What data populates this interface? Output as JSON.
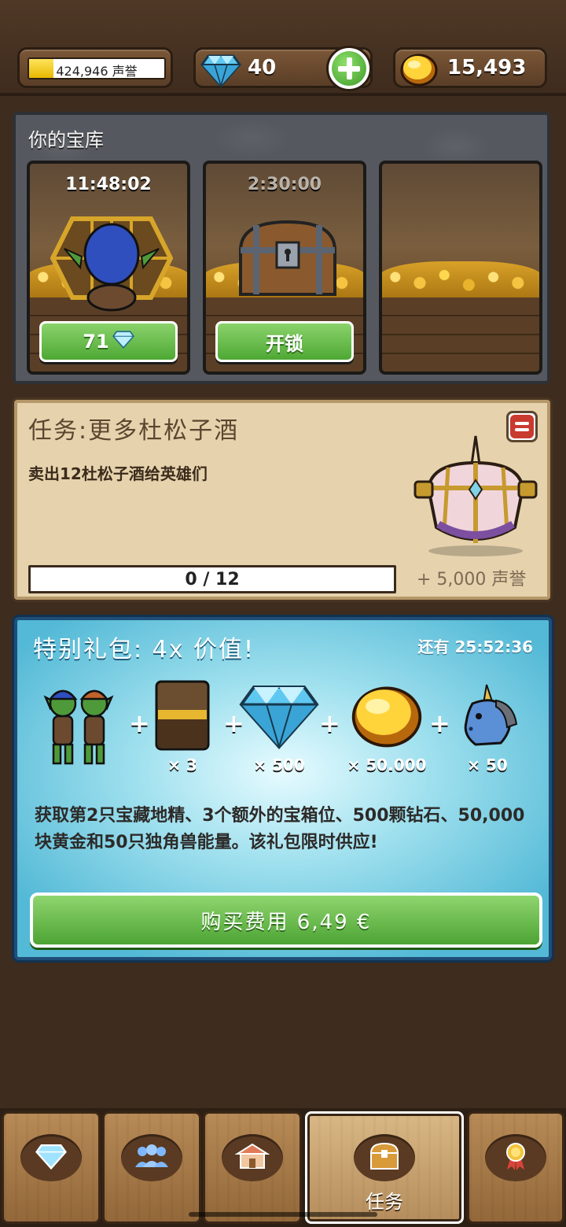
{
  "topbar": {
    "fame_text": "424,946 声誉",
    "fame_progress": 0.18,
    "gems": "40",
    "gold": "15,493"
  },
  "vault": {
    "title": "你的宝库",
    "slots": [
      {
        "timer": "11:48:02",
        "button": "71",
        "art": "goblin-cage"
      },
      {
        "timer": "2:30:00",
        "button": "开锁",
        "art": "wooden-chest"
      },
      {
        "timer": "",
        "button": "",
        "art": "empty"
      }
    ]
  },
  "quest": {
    "title": "任务:更多杜松子酒",
    "description": "卖出12杜松子酒给英雄们",
    "progress_text": "0 / 12",
    "progress": 0,
    "reward": "+ 5,000 声誉"
  },
  "offer": {
    "title": "特别礼包: 4x 价值!",
    "timer": "还有 25:52:36",
    "items": [
      {
        "icon": "goblins-icon",
        "qty": ""
      },
      {
        "icon": "vault-slot-icon",
        "qty": "× 3"
      },
      {
        "icon": "diamond-icon",
        "qty": "× 500"
      },
      {
        "icon": "gold-coin-icon",
        "qty": "× 50.000"
      },
      {
        "icon": "unicorn-icon",
        "qty": "× 50"
      }
    ],
    "description": "获取第2只宝藏地精、3个额外的宝箱位、500颗钻石、50,000块黄金和50只独角兽能量。该礼包限时供应!",
    "buy_label": "购买费用 6,49 €"
  },
  "nav": {
    "tabs": [
      {
        "icon": "gem-shop-icon",
        "label": ""
      },
      {
        "icon": "heroes-icon",
        "label": ""
      },
      {
        "icon": "shop-icon",
        "label": ""
      },
      {
        "icon": "quest-chest-icon",
        "label": "任务",
        "active": true
      },
      {
        "icon": "achievement-medal-icon",
        "label": ""
      }
    ]
  },
  "colors": {
    "brown_bg": "#3e2c1f",
    "button_green": "#4ea834",
    "offer_blue": "#53b9d6",
    "quest_parchment": "#e6d3ad"
  }
}
